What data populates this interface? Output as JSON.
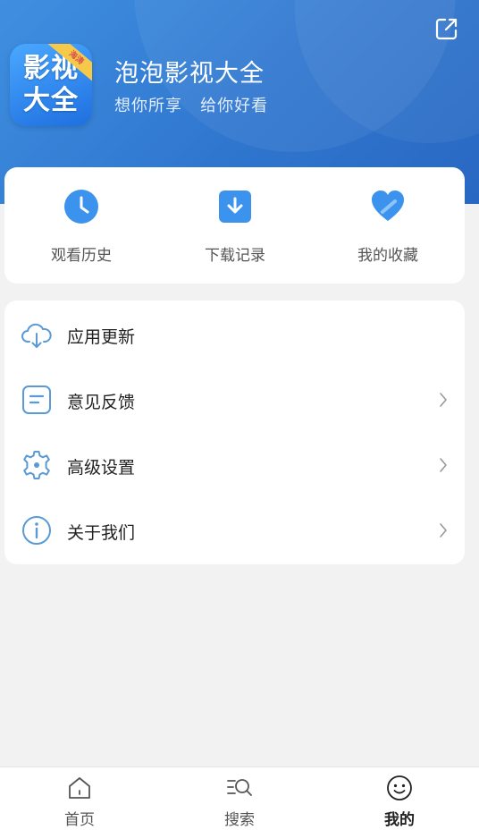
{
  "profile": {
    "logo_text": "影视\n大全",
    "logo_ribbon": "海涛",
    "app_name": "泡泡影视大全",
    "slogan": "想你所享   给你好看"
  },
  "quick_actions": [
    {
      "label": "观看历史",
      "icon": "clock-icon"
    },
    {
      "label": "下载记录",
      "icon": "download-icon"
    },
    {
      "label": "我的收藏",
      "icon": "heart-icon"
    }
  ],
  "menu": [
    {
      "label": "应用更新",
      "icon": "cloud-download-icon",
      "chevron": false
    },
    {
      "label": "意见反馈",
      "icon": "feedback-icon",
      "chevron": true
    },
    {
      "label": "高级设置",
      "icon": "gear-icon",
      "chevron": true
    },
    {
      "label": "关于我们",
      "icon": "info-icon",
      "chevron": true
    }
  ],
  "tabbar": [
    {
      "label": "首页",
      "icon": "home-icon",
      "active": false
    },
    {
      "label": "搜索",
      "icon": "search-list-icon",
      "active": false
    },
    {
      "label": "我的",
      "icon": "smiley-icon",
      "active": true
    }
  ],
  "colors": {
    "header_blue": "#2f76cf",
    "accent_blue": "#3c93ee",
    "icon_outline": "#5a9ad6"
  }
}
